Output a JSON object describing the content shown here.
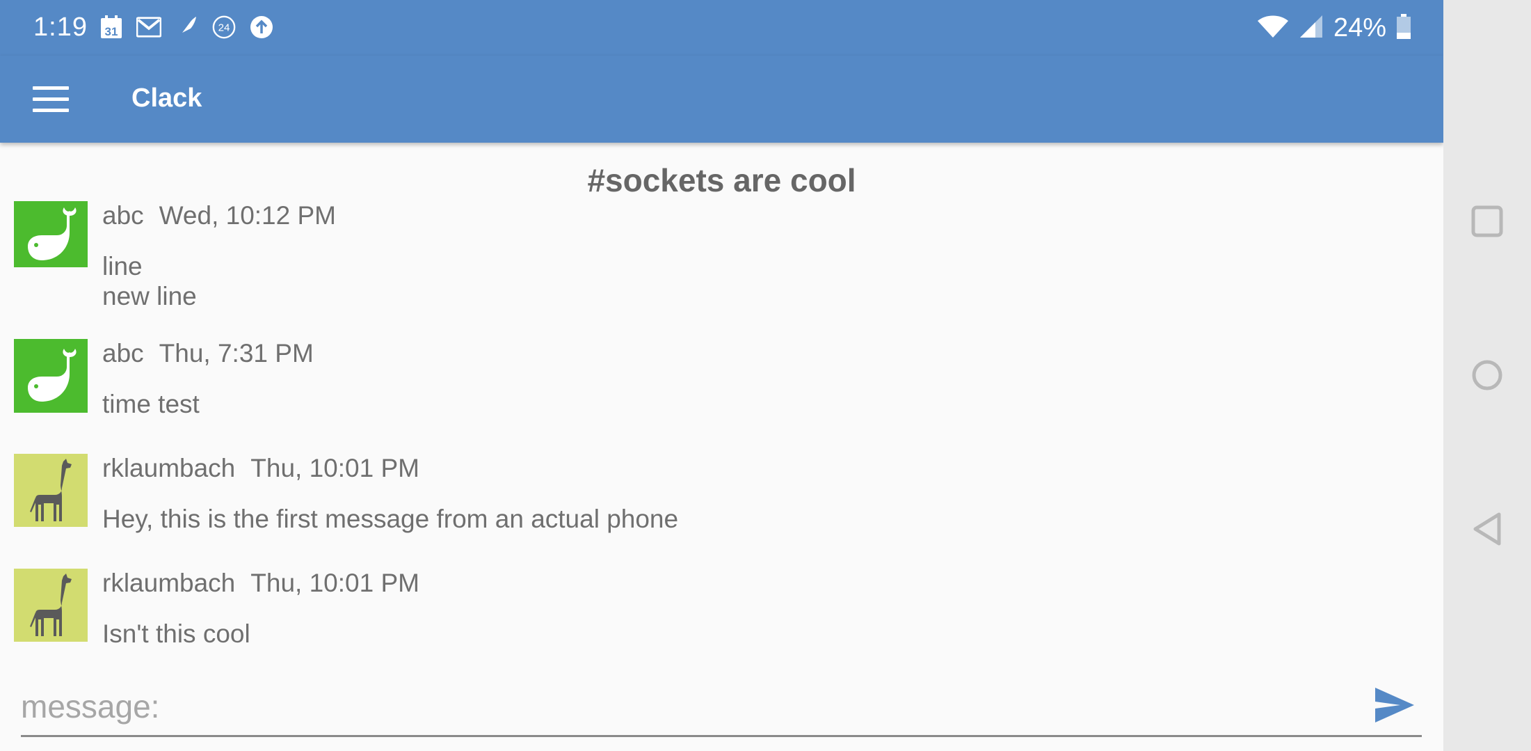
{
  "status_bar": {
    "time": "1:19",
    "calendar_day": "31",
    "badge_number": "24",
    "battery": "24%"
  },
  "app_bar": {
    "title": "Clack"
  },
  "channel": {
    "title": "#sockets are cool"
  },
  "messages": [
    {
      "user": "abc",
      "time": "Wed, 10:12 PM",
      "lines": [
        "line",
        "new line"
      ],
      "avatar": "whale-icon"
    },
    {
      "user": "abc",
      "time": "Thu, 7:31 PM",
      "lines": [
        "time test"
      ],
      "avatar": "whale-icon"
    },
    {
      "user": "rklaumbach",
      "time": "Thu, 10:01 PM",
      "lines": [
        "Hey, this is the first message from an actual phone"
      ],
      "avatar": "giraffe-icon"
    },
    {
      "user": "rklaumbach",
      "time": "Thu, 10:01 PM",
      "lines": [
        "Isn't this cool"
      ],
      "avatar": "giraffe-icon"
    }
  ],
  "composer": {
    "placeholder": "message:",
    "value": ""
  },
  "colors": {
    "primary": "#5589c6",
    "whale_avatar_bg": "#4cbb2e",
    "giraffe_avatar_bg": "#d2dc70",
    "text": "#6f6f6f"
  }
}
